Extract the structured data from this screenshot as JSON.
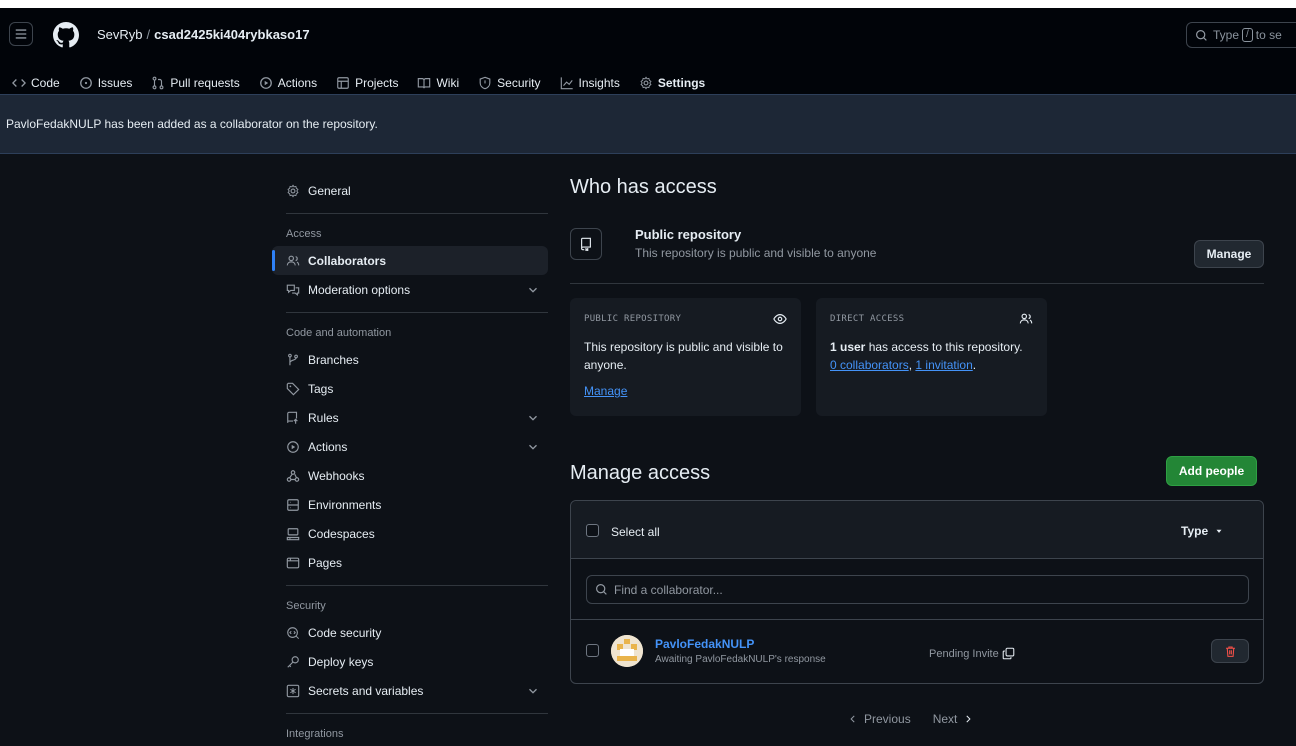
{
  "header": {
    "owner": "SevRyb",
    "separator": "/",
    "repo": "csad2425ki404rybkaso17",
    "search_prefix": "Type",
    "search_key": "/",
    "search_suffix": "to se"
  },
  "tabs": [
    {
      "label": "Code",
      "icon": "code-icon"
    },
    {
      "label": "Issues",
      "icon": "issue-icon"
    },
    {
      "label": "Pull requests",
      "icon": "git-pull-request-icon"
    },
    {
      "label": "Actions",
      "icon": "play-icon"
    },
    {
      "label": "Projects",
      "icon": "table-icon"
    },
    {
      "label": "Wiki",
      "icon": "book-icon"
    },
    {
      "label": "Security",
      "icon": "shield-icon"
    },
    {
      "label": "Insights",
      "icon": "graph-icon"
    },
    {
      "label": "Settings",
      "icon": "gear-icon",
      "active": true
    }
  ],
  "flash": {
    "message": "PavloFedakNULP has been added as a collaborator on the repository."
  },
  "sidebar": {
    "general": "General",
    "access_heading": "Access",
    "collaborators": "Collaborators",
    "moderation": "Moderation options",
    "code_heading": "Code and automation",
    "branches": "Branches",
    "tags": "Tags",
    "rules": "Rules",
    "actions": "Actions",
    "webhooks": "Webhooks",
    "environments": "Environments",
    "codespaces": "Codespaces",
    "pages": "Pages",
    "security_heading": "Security",
    "code_security": "Code security",
    "deploy_keys": "Deploy keys",
    "secrets": "Secrets and variables",
    "integrations_heading": "Integrations"
  },
  "main": {
    "who_title": "Who has access",
    "public_title": "Public repository",
    "public_desc": "This repository is public and visible to anyone",
    "manage_button": "Manage",
    "card_public": {
      "heading": "PUBLIC REPOSITORY",
      "body": "This repository is public and visible to anyone.",
      "link": "Manage"
    },
    "card_direct": {
      "heading": "DIRECT ACCESS",
      "count": "1 user",
      "body_rest": " has access to this repository.",
      "link_collab": "0 collaborators",
      "comma": ", ",
      "link_invite": "1 invitation",
      "period": "."
    },
    "manage_title": "Manage access",
    "add_people": "Add people",
    "select_all": "Select all",
    "type_filter": "Type",
    "find_placeholder": "Find a collaborator...",
    "collaborator": {
      "name": "PavloFedakNULP",
      "status": "Awaiting PavloFedakNULP's response",
      "pending": "Pending Invite"
    },
    "pager": {
      "previous": "Previous",
      "next": "Next"
    }
  },
  "colors": {
    "accent_green": "#238636",
    "link_blue": "#4493f8",
    "tab_underline": "#f78166",
    "danger": "#f85149"
  }
}
